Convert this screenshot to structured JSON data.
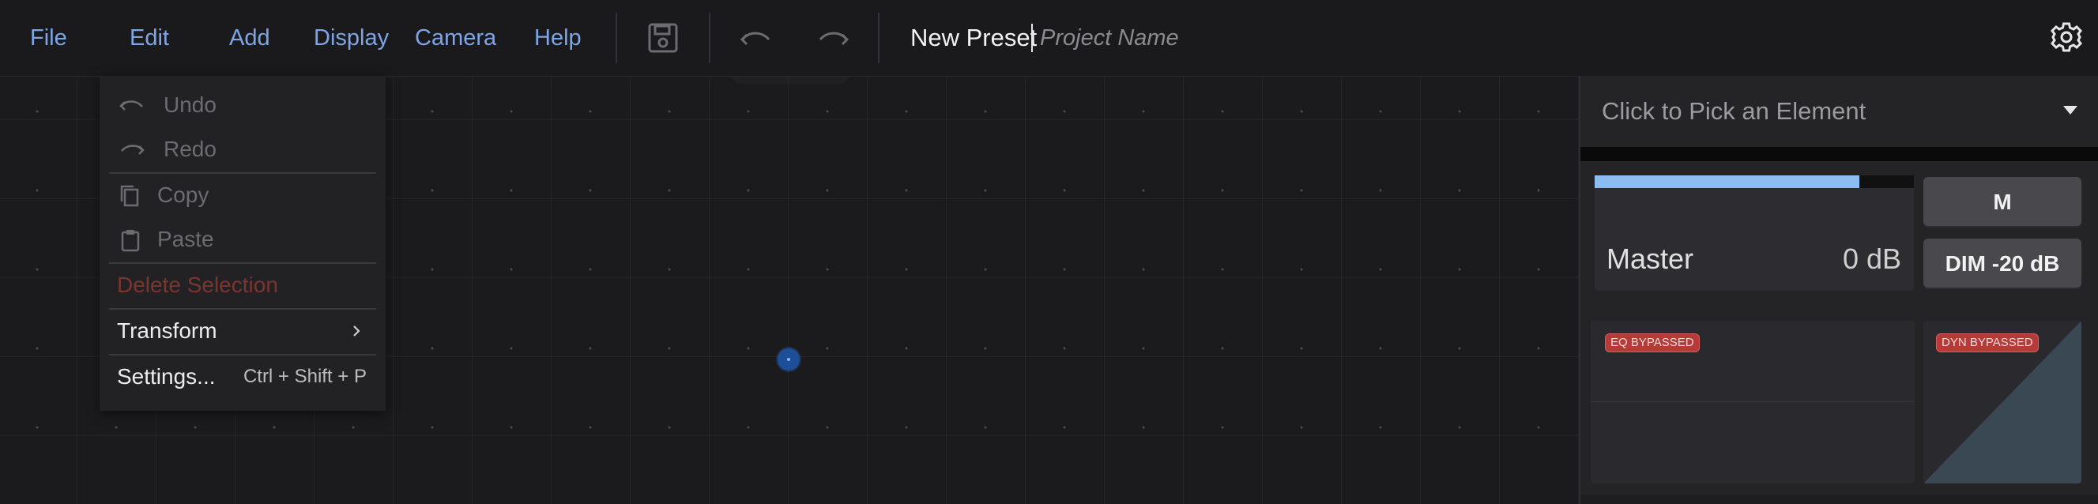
{
  "menubar": {
    "items": [
      {
        "label": "File"
      },
      {
        "label": "Edit"
      },
      {
        "label": "Add"
      },
      {
        "label": "Display"
      },
      {
        "label": "Camera"
      },
      {
        "label": "Help"
      }
    ],
    "icons": [
      "save-icon",
      "undo-icon",
      "redo-icon"
    ]
  },
  "title": {
    "preset": "New Preset",
    "project_placeholder": "Project Name"
  },
  "edit_menu": {
    "undo": "Undo",
    "redo": "Redo",
    "copy": "Copy",
    "paste": "Paste",
    "delete_selection": "Delete Selection",
    "transform": "Transform",
    "settings": "Settings...",
    "settings_shortcut": "Ctrl + Shift + P"
  },
  "panel": {
    "picker_label": "Click to Pick an Element",
    "master": {
      "label": "Master",
      "value": "0 dB",
      "meter_level": 0.83
    },
    "mute_label": "M",
    "dim_label": "DIM -20 dB",
    "eq_badge": "EQ BYPASSED",
    "dyn_badge": "DYN BYPASSED"
  },
  "colors": {
    "accent": "#7ea6e6",
    "meter": "#8dbcf0",
    "badge": "#b53a38",
    "background": "#1b1b1d"
  }
}
